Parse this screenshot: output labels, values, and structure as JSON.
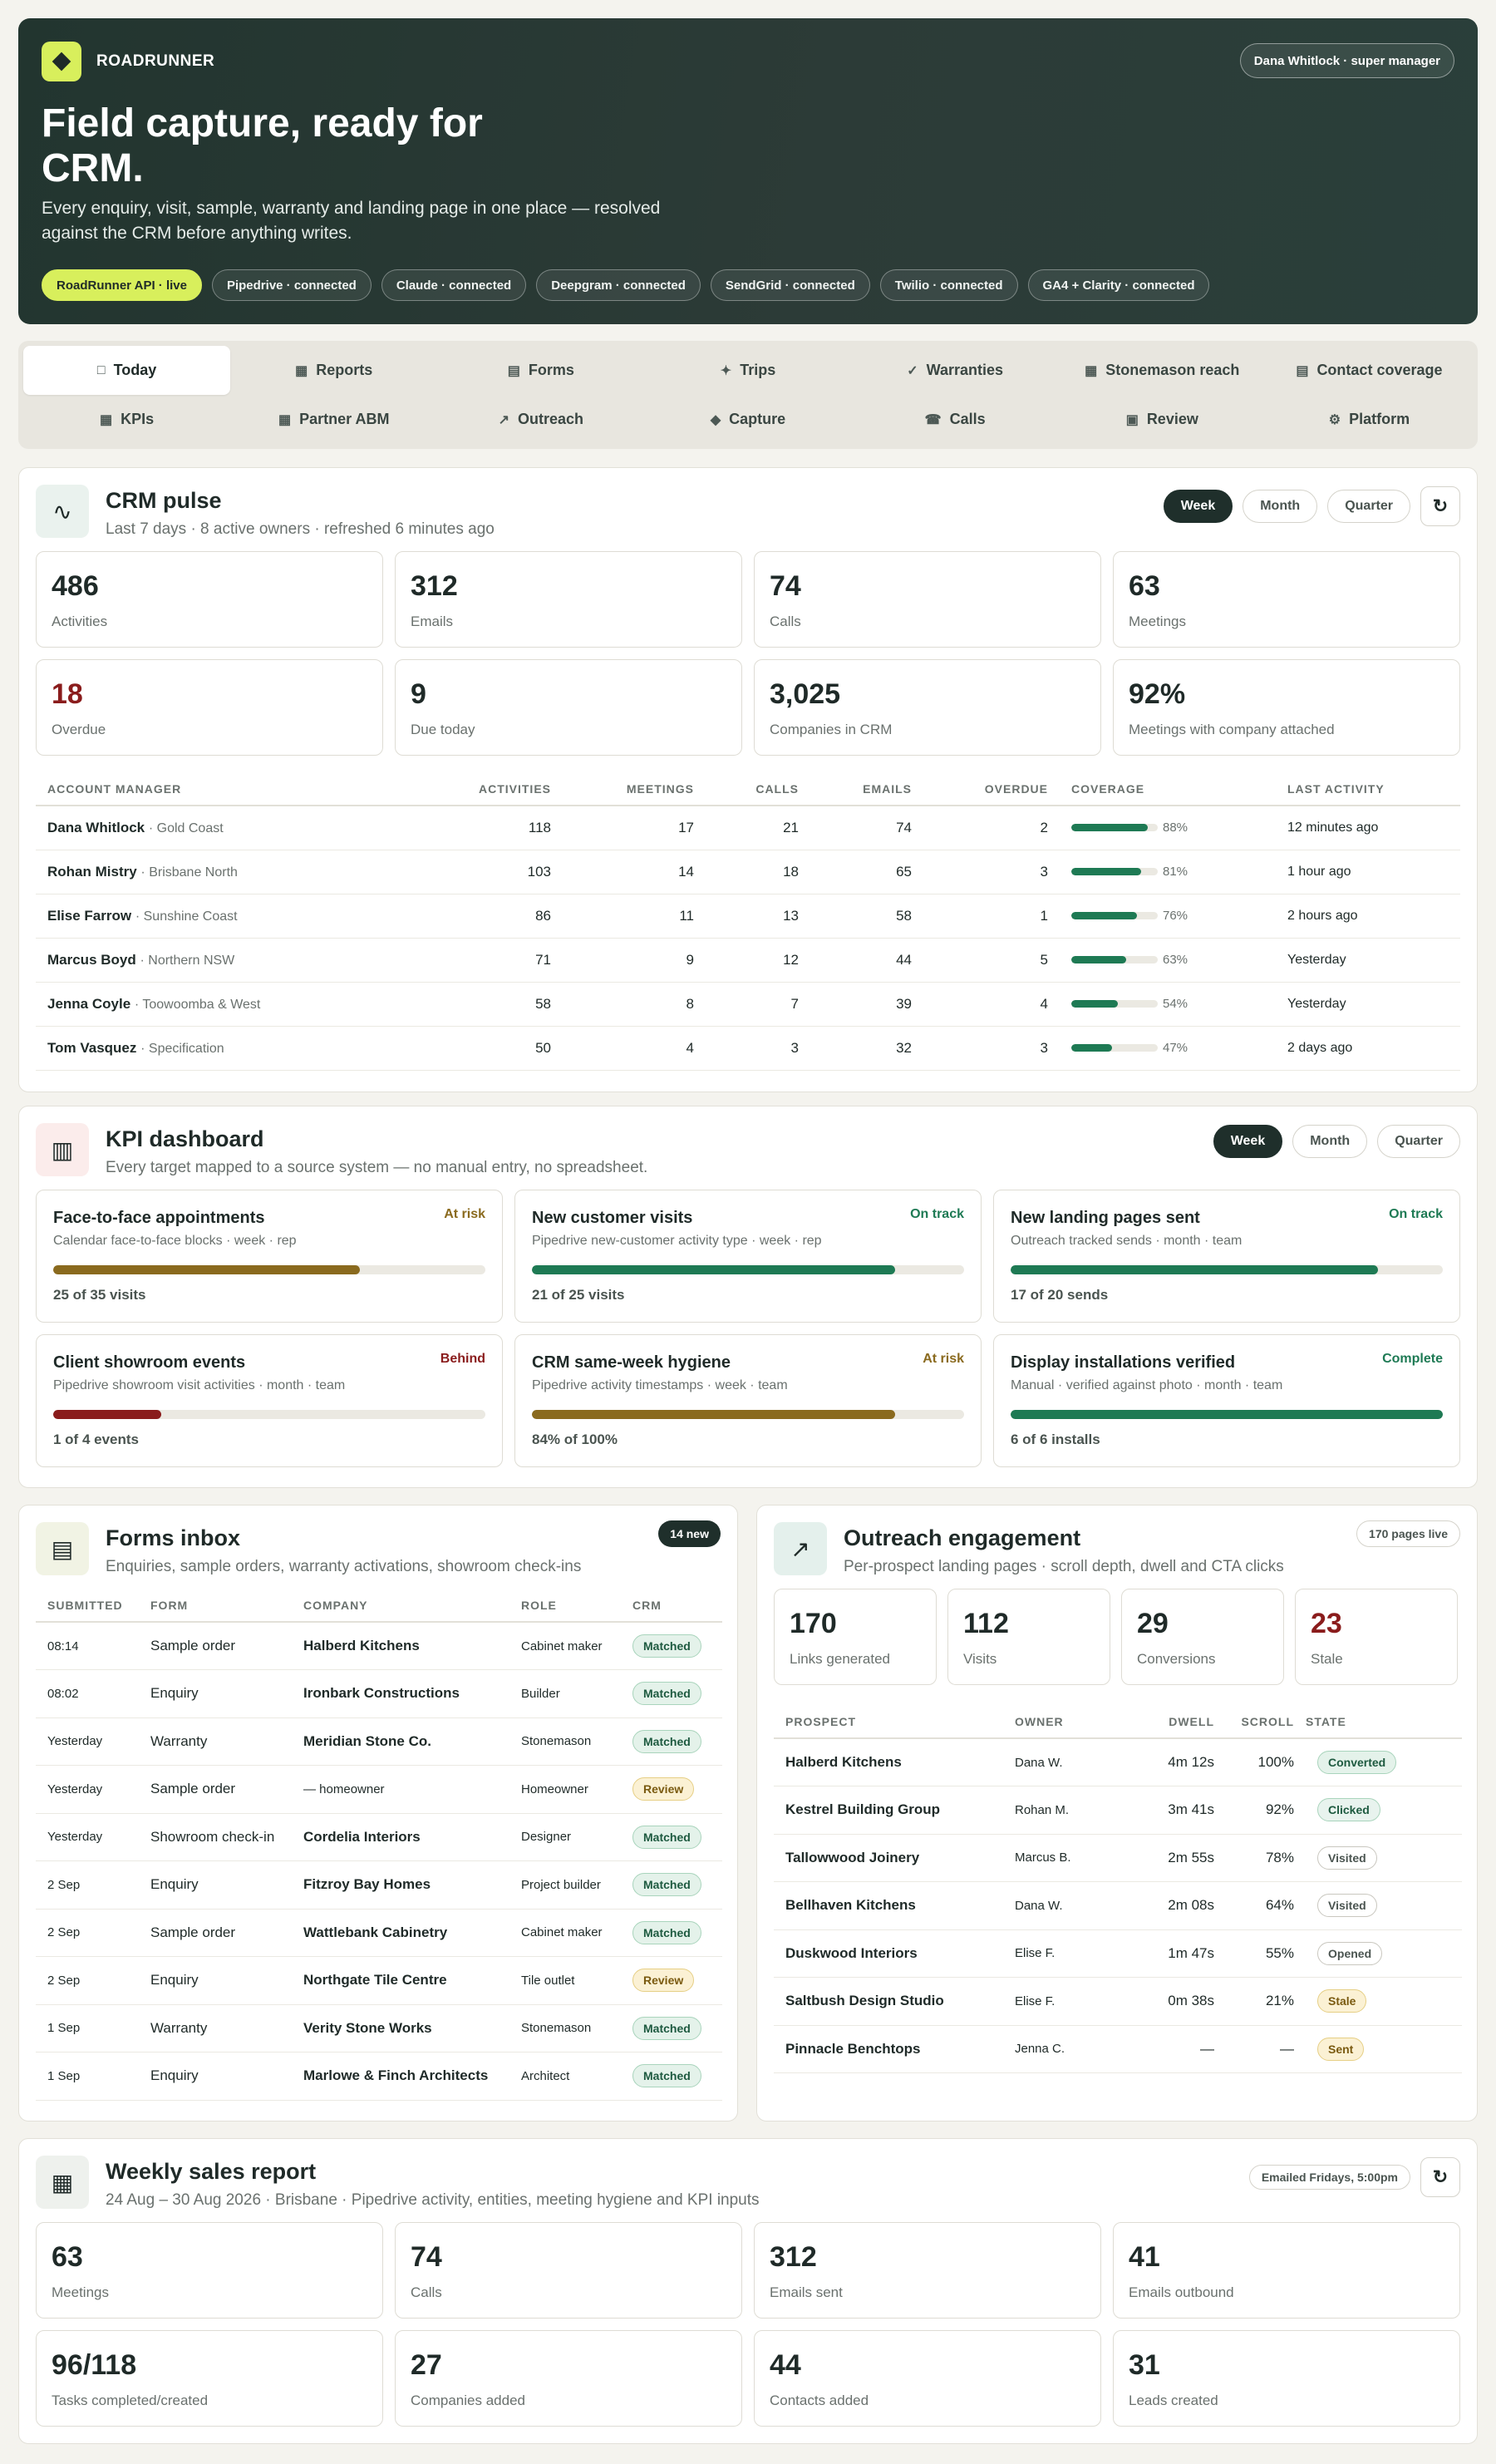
{
  "brand": "ROADRUNNER",
  "user": "Dana Whitlock · super manager",
  "hero": {
    "title": "Field capture, ready for CRM.",
    "subtitle": "Every enquiry, visit, sample, warranty and landing page in one place — resolved against the CRM before anything writes.",
    "pills": [
      "RoadRunner API · live",
      "Pipedrive · connected",
      "Claude · connected",
      "Deepgram · connected",
      "SendGrid · connected",
      "Twilio · connected",
      "GA4 + Clarity · connected"
    ]
  },
  "nav": [
    {
      "label": "Today",
      "icon": "□"
    },
    {
      "label": "Reports",
      "icon": "▦"
    },
    {
      "label": "Forms",
      "icon": "▤"
    },
    {
      "label": "Trips",
      "icon": "✦"
    },
    {
      "label": "Warranties",
      "icon": "✓"
    },
    {
      "label": "Stonemason reach",
      "icon": "▦"
    },
    {
      "label": "Contact coverage",
      "icon": "▤"
    },
    {
      "label": "KPIs",
      "icon": "▦"
    },
    {
      "label": "Partner ABM",
      "icon": "▦"
    },
    {
      "label": "Outreach",
      "icon": "↗"
    },
    {
      "label": "Capture",
      "icon": "◆"
    },
    {
      "label": "Calls",
      "icon": "☎"
    },
    {
      "label": "Review",
      "icon": "▣"
    },
    {
      "label": "Platform",
      "icon": "⚙"
    }
  ],
  "pulse": {
    "title": "CRM pulse",
    "sub": "Last 7 days · 8 active owners · refreshed 6 minutes ago",
    "icon": "∿",
    "periods": [
      "Week",
      "Month",
      "Quarter"
    ],
    "stats": [
      [
        "486",
        "Activities"
      ],
      [
        "312",
        "Emails"
      ],
      [
        "74",
        "Calls"
      ],
      [
        "63",
        "Meetings"
      ],
      [
        "18",
        "Overdue"
      ],
      [
        "9",
        "Due today"
      ],
      [
        "3,025",
        "Companies in CRM"
      ],
      [
        "92%",
        "Meetings with company attached"
      ]
    ],
    "cols": [
      "ACCOUNT MANAGER",
      "ACTIVITIES",
      "MEETINGS",
      "CALLS",
      "EMAILS",
      "OVERDUE",
      "COVERAGE",
      "LAST ACTIVITY"
    ],
    "rows": [
      [
        "Dana Whitlock",
        "· Gold Coast",
        "118",
        "17",
        "21",
        "74",
        "2",
        88,
        "88%",
        "12 minutes ago"
      ],
      [
        "Rohan Mistry",
        "· Brisbane North",
        "103",
        "14",
        "18",
        "65",
        "3",
        81,
        "81%",
        "1 hour ago"
      ],
      [
        "Elise Farrow",
        "· Sunshine Coast",
        "86",
        "11",
        "13",
        "58",
        "1",
        76,
        "76%",
        "2 hours ago"
      ],
      [
        "Marcus Boyd",
        "· Northern NSW",
        "71",
        "9",
        "12",
        "44",
        "5",
        63,
        "63%",
        "Yesterday"
      ],
      [
        "Jenna Coyle",
        "· Toowoomba & West",
        "58",
        "8",
        "7",
        "39",
        "4",
        54,
        "54%",
        "Yesterday"
      ],
      [
        "Tom Vasquez",
        "· Specification",
        "50",
        "4",
        "3",
        "32",
        "3",
        47,
        "47%",
        "2 days ago"
      ]
    ]
  },
  "kpi": {
    "title": "KPI dashboard",
    "sub": "Every target mapped to a source system — no manual entry, no spreadsheet.",
    "icon": "▥",
    "periods": [
      "Week",
      "Month",
      "Quarter"
    ],
    "cards": [
      {
        "t": "Face-to-face appointments",
        "s": "Calendar face-to-face blocks · week · rep",
        "st": "At risk",
        "v": "25 of 35 visits",
        "p": 71,
        "c": "#8a6a1e"
      },
      {
        "t": "New customer visits",
        "s": "Pipedrive new-customer activity type · week · rep",
        "st": "On track",
        "v": "21 of 25 visits",
        "p": 84,
        "c": "#1e7a54"
      },
      {
        "t": "New landing pages sent",
        "s": "Outreach tracked sends · month · team",
        "st": "On track",
        "v": "17 of 20 sends",
        "p": 85,
        "c": "#1e7a54"
      },
      {
        "t": "Client showroom events",
        "s": "Pipedrive showroom visit activities · month · team",
        "st": "Behind",
        "v": "1 of 4 events",
        "p": 25,
        "c": "#8a1c1c"
      },
      {
        "t": "CRM same-week hygiene",
        "s": "Pipedrive activity timestamps · week · team",
        "st": "At risk",
        "v": "84% of 100%",
        "p": 84,
        "c": "#8a6a1e"
      },
      {
        "t": "Display installations verified",
        "s": "Manual · verified against photo · month · team",
        "st": "Complete",
        "v": "6 of 6 installs",
        "p": 100,
        "c": "#1e7a54"
      }
    ]
  },
  "forms": {
    "title": "Forms inbox",
    "sub": "Enquiries, sample orders, warranty activations, showroom check-ins",
    "badge": "14 new",
    "icon": "▤",
    "cols": [
      "SUBMITTED",
      "FORM",
      "COMPANY",
      "ROLE",
      "CRM"
    ],
    "rows": [
      [
        "08:14",
        "Sample order",
        "Halberd Kitchens",
        "Cabinet maker",
        "Matched"
      ],
      [
        "08:02",
        "Enquiry",
        "Ironbark Constructions",
        "Builder",
        "Matched"
      ],
      [
        "Yesterday",
        "Warranty",
        "Meridian Stone Co.",
        "Stonemason",
        "Matched"
      ],
      [
        "Yesterday",
        "Sample order",
        "— homeowner",
        "Homeowner",
        "Review"
      ],
      [
        "Yesterday",
        "Showroom check-in",
        "Cordelia Interiors",
        "Designer",
        "Matched"
      ],
      [
        "2 Sep",
        "Enquiry",
        "Fitzroy Bay Homes",
        "Project builder",
        "Matched"
      ],
      [
        "2 Sep",
        "Sample order",
        "Wattlebank Cabinetry",
        "Cabinet maker",
        "Matched"
      ],
      [
        "2 Sep",
        "Enquiry",
        "Northgate Tile Centre",
        "Tile outlet",
        "Review"
      ],
      [
        "1 Sep",
        "Warranty",
        "Verity Stone Works",
        "Stonemason",
        "Matched"
      ],
      [
        "1 Sep",
        "Enquiry",
        "Marlowe & Finch Architects",
        "Architect",
        "Matched"
      ]
    ]
  },
  "outreach": {
    "title": "Outreach engagement",
    "sub": "Per-prospect landing pages · scroll depth, dwell and CTA clicks",
    "tag": "170 pages live",
    "icon": "↗",
    "stats": [
      [
        "170",
        "Links generated"
      ],
      [
        "112",
        "Visits"
      ],
      [
        "29",
        "Conversions"
      ],
      [
        "23",
        "Stale"
      ]
    ],
    "cols": [
      "PROSPECT",
      "OWNER",
      "DWELL",
      "SCROLL",
      "STATE"
    ],
    "rows": [
      [
        "Halberd Kitchens",
        "Dana W.",
        "4m 12s",
        "100%",
        "Converted"
      ],
      [
        "Kestrel Building Group",
        "Rohan M.",
        "3m 41s",
        "92%",
        "Clicked"
      ],
      [
        "Tallowwood Joinery",
        "Marcus B.",
        "2m 55s",
        "78%",
        "Visited"
      ],
      [
        "Bellhaven Kitchens",
        "Dana W.",
        "2m 08s",
        "64%",
        "Visited"
      ],
      [
        "Duskwood Interiors",
        "Elise F.",
        "1m 47s",
        "55%",
        "Opened"
      ],
      [
        "Saltbush Design Studio",
        "Elise F.",
        "0m 38s",
        "21%",
        "Stale"
      ],
      [
        "Pinnacle Benchtops",
        "Jenna C.",
        "—",
        "—",
        "Sent"
      ]
    ]
  },
  "weekly": {
    "title": "Weekly sales report",
    "sub": "24 Aug – 30 Aug 2026 · Brisbane · Pipedrive activity, entities, meeting hygiene and KPI inputs",
    "tag": "Emailed Fridays, 5:00pm",
    "icon": "▦",
    "stats": [
      [
        "63",
        "Meetings"
      ],
      [
        "74",
        "Calls"
      ],
      [
        "312",
        "Emails sent"
      ],
      [
        "41",
        "Emails outbound"
      ],
      [
        "96/118",
        "Tasks completed/created"
      ],
      [
        "27",
        "Companies added"
      ],
      [
        "44",
        "Contacts added"
      ],
      [
        "31",
        "Leads created"
      ]
    ]
  }
}
